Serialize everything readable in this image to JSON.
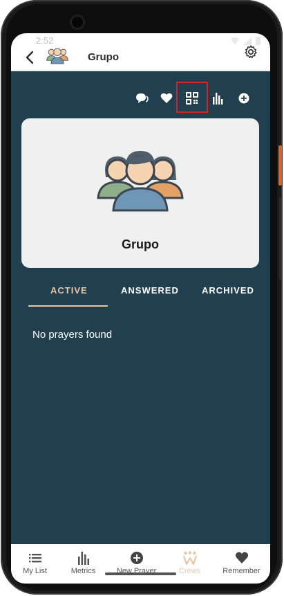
{
  "status_bar": {
    "time": "2:52"
  },
  "header": {
    "title": "Grupo"
  },
  "card": {
    "group_name": "Grupo"
  },
  "tabs": [
    {
      "label": "ACTIVE",
      "active": true
    },
    {
      "label": "ANSWERED",
      "active": false
    },
    {
      "label": "ARCHIVED",
      "active": false
    }
  ],
  "content": {
    "empty_message": "No prayers found"
  },
  "bottom_nav": [
    {
      "label": "My List",
      "icon": "list-icon"
    },
    {
      "label": "Metrics",
      "icon": "bar-chart-icon"
    },
    {
      "label": "New Prayer",
      "icon": "plus-circle-icon"
    },
    {
      "label": "Crews",
      "icon": "crew-icon",
      "active": true
    },
    {
      "label": "Remember",
      "icon": "heart-icon"
    }
  ],
  "colors": {
    "background": "#223f4f",
    "accent": "#e6c7a6",
    "highlight": "#d4242a",
    "card": "#f0f0f0"
  }
}
